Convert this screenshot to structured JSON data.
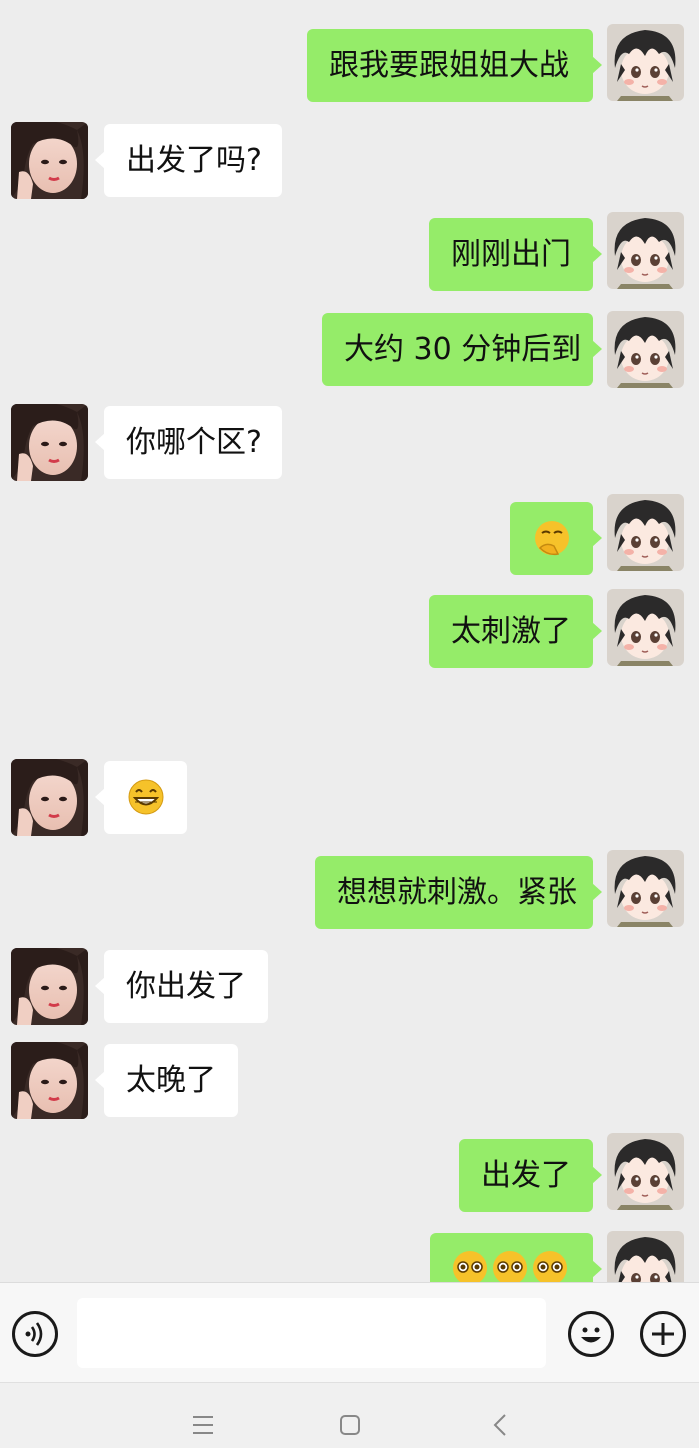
{
  "messages": [
    {
      "side": "right",
      "text": "跟我要跟姐姐大战"
    },
    {
      "side": "left",
      "text": "出发了吗?"
    },
    {
      "side": "right",
      "text": "刚刚出门"
    },
    {
      "side": "right",
      "text": "大约 30 分钟后到"
    },
    {
      "side": "left",
      "text": "你哪个区?"
    },
    {
      "side": "right",
      "emoji": "smirk-hand-emoji"
    },
    {
      "side": "right",
      "text": "太刺激了"
    },
    {
      "side": "left",
      "emoji": "grin-emoji"
    },
    {
      "side": "right",
      "text": "想想就刺激。紧张"
    },
    {
      "side": "left",
      "text": "你出发了"
    },
    {
      "side": "left",
      "text": "太晚了"
    },
    {
      "side": "right",
      "text": "出发了"
    },
    {
      "side": "right",
      "emoji": "pleading-emoji-x3"
    }
  ],
  "input": {
    "placeholder": "",
    "value": ""
  },
  "icons": {
    "voice": "voice-icon",
    "emoji": "emoji-icon",
    "plus": "plus-icon",
    "nav_menu": "menu-icon",
    "nav_home": "home-icon",
    "nav_back": "back-icon"
  },
  "colors": {
    "background": "#ededed",
    "sent_bubble": "#95ec69",
    "received_bubble": "#ffffff"
  }
}
